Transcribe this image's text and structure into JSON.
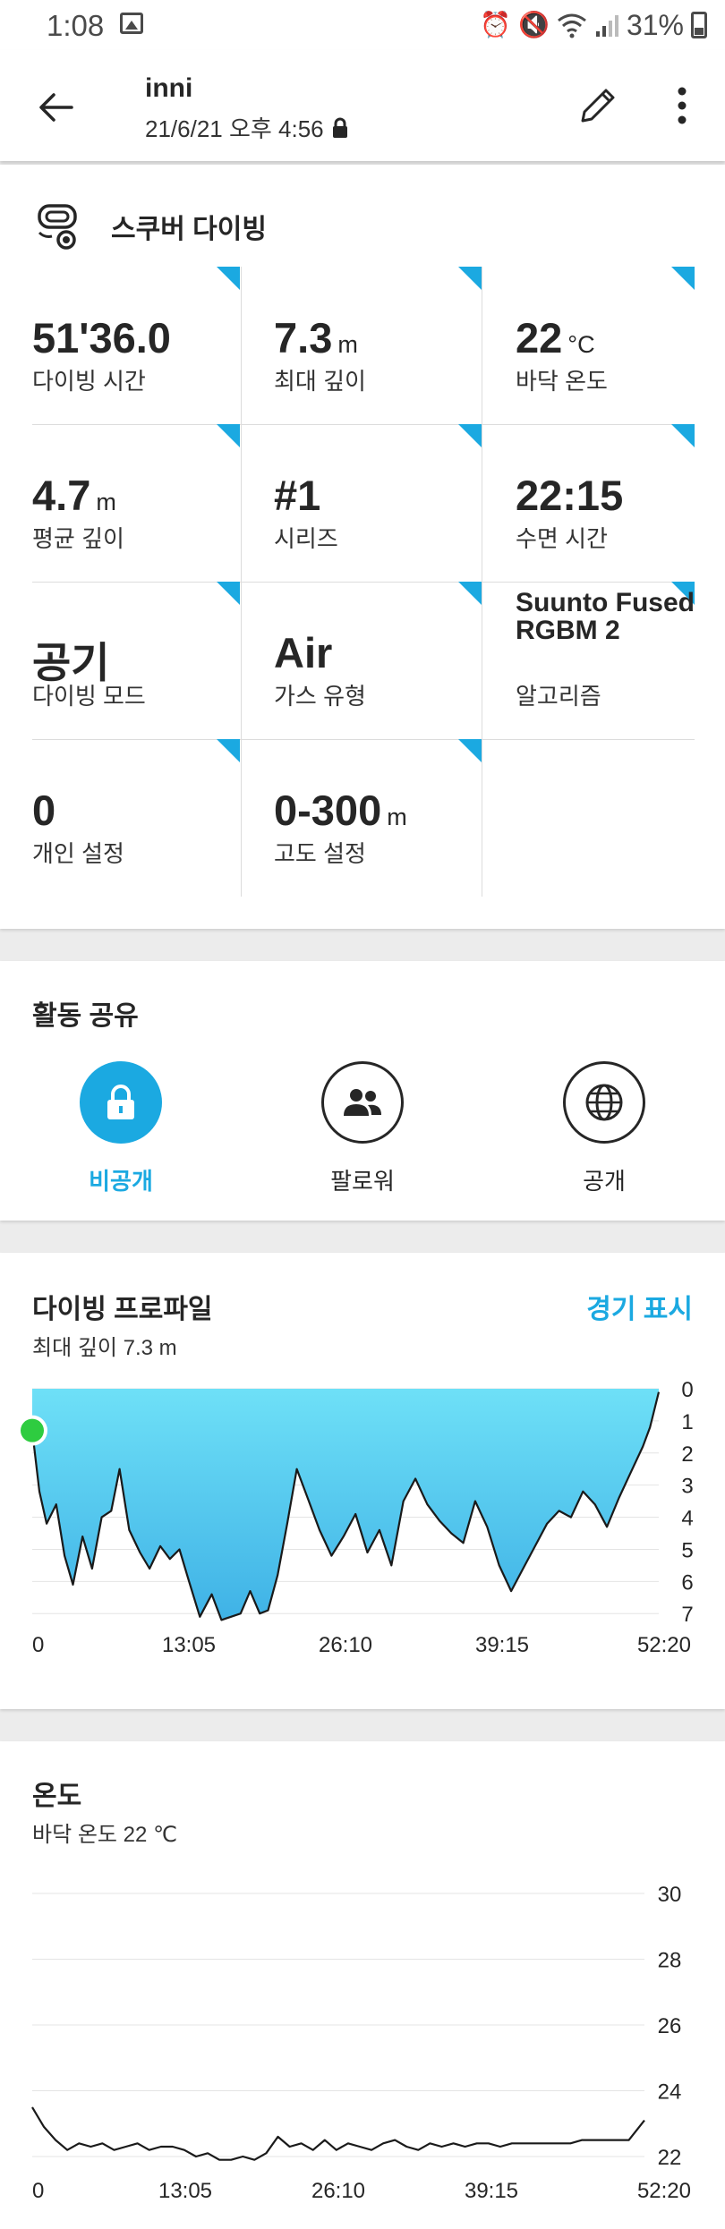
{
  "status_bar": {
    "time": "1:08",
    "battery": "31%"
  },
  "header": {
    "title": "inni",
    "datetime": "21/6/21 오후 4:56"
  },
  "activity": {
    "name": "스쿠버 다이빙"
  },
  "stats": [
    {
      "value": "51'36.0",
      "unit": "",
      "label": "다이빙 시간"
    },
    {
      "value": "7.3",
      "unit": "m",
      "label": "최대 깊이"
    },
    {
      "value": "22",
      "unit": "°C",
      "label": "바닥 온도"
    },
    {
      "value": "4.7",
      "unit": "m",
      "label": "평균 깊이"
    },
    {
      "value": "#1",
      "unit": "",
      "label": "시리즈"
    },
    {
      "value": "22:15",
      "unit": "",
      "label": "수면 시간"
    },
    {
      "value": "공기",
      "unit": "",
      "label": "다이빙 모드"
    },
    {
      "value": "Air",
      "unit": "",
      "label": "가스 유형"
    },
    {
      "value": "Suunto Fused RGBM 2",
      "unit": "",
      "label": "알고리즘"
    },
    {
      "value": "0",
      "unit": "",
      "label": "개인 설정"
    },
    {
      "value": "0-300",
      "unit": "m",
      "label": "고도 설정"
    }
  ],
  "share": {
    "title": "활동 공유",
    "options": [
      {
        "label": "비공개",
        "selected": true
      },
      {
        "label": "팔로워",
        "selected": false
      },
      {
        "label": "공개",
        "selected": false
      }
    ]
  },
  "profile": {
    "title": "다이빙 프로파일",
    "link": "경기 표시",
    "subtitle": "최대 깊이 7.3 m"
  },
  "temperature": {
    "title": "온도",
    "subtitle": "바닥 온도 22 ℃"
  },
  "colors": {
    "accent": "#1ba9e1",
    "corner": "#1ba9e1",
    "depth_fill_top": "#6ee0f7",
    "depth_fill_bottom": "#3fb2e6",
    "start_marker": "#2ecc40"
  },
  "chart_data": [
    {
      "type": "area",
      "x_tick_labels": [
        "0",
        "13:05",
        "26:10",
        "39:15",
        "52:20"
      ],
      "y_tick_labels": [
        "0",
        "1",
        "2",
        "3",
        "4",
        "5",
        "6",
        "7"
      ],
      "ylim": [
        0,
        7.3
      ],
      "y_inverted": true,
      "xlim": [
        0,
        52.33
      ],
      "series": [
        {
          "x": [
            0,
            0.6,
            1.2,
            2,
            2.7,
            3.4,
            4.2,
            5,
            5.8,
            6.6,
            7.3,
            8.1,
            9,
            9.8,
            10.7,
            11.5,
            12.3,
            13.1,
            14,
            15,
            15.8,
            16.6,
            17.4,
            18.2,
            19,
            19.7,
            20.5,
            21.3,
            22.1,
            23,
            24,
            25,
            26,
            27,
            28,
            29,
            30,
            31,
            32,
            33,
            34,
            35,
            36,
            37,
            38,
            39,
            40,
            41,
            42,
            43,
            44,
            45,
            46,
            47,
            48,
            49,
            50,
            51,
            51.6,
            52.33
          ],
          "y": [
            1.3,
            3.2,
            4.2,
            3.6,
            5.2,
            6.1,
            4.6,
            5.6,
            4.0,
            3.8,
            2.5,
            4.4,
            5.1,
            5.6,
            4.9,
            5.3,
            5.0,
            6.0,
            7.1,
            6.4,
            7.2,
            7.1,
            7.0,
            6.3,
            7.0,
            6.9,
            5.8,
            4.2,
            2.5,
            3.4,
            4.4,
            5.2,
            4.6,
            3.9,
            5.1,
            4.4,
            5.5,
            3.5,
            2.8,
            3.6,
            4.1,
            4.5,
            4.8,
            3.5,
            4.3,
            5.5,
            6.3,
            5.6,
            4.9,
            4.2,
            3.8,
            4.0,
            3.2,
            3.6,
            4.3,
            3.4,
            2.6,
            1.8,
            1.2,
            0.1
          ]
        }
      ]
    },
    {
      "type": "line",
      "x_tick_labels": [
        "0",
        "13:05",
        "26:10",
        "39:15",
        "52:20"
      ],
      "y_tick_labels": [
        "30",
        "28",
        "26",
        "24",
        "22"
      ],
      "ylim": [
        21.5,
        30
      ],
      "xlim": [
        0,
        52.33
      ],
      "series": [
        {
          "x": [
            0,
            1,
            2,
            3,
            4,
            5,
            6,
            7,
            8,
            9,
            10,
            11,
            12,
            13,
            14,
            15,
            16,
            17,
            18,
            19,
            20,
            21,
            22,
            23,
            24,
            25,
            26,
            27,
            28,
            29,
            30,
            31,
            32,
            33,
            34,
            35,
            36,
            37,
            38,
            39,
            40,
            41,
            42,
            43,
            44,
            45,
            46,
            47,
            48,
            49,
            50,
            51,
            52.33
          ],
          "y": [
            23.5,
            22.9,
            22.5,
            22.2,
            22.4,
            22.3,
            22.4,
            22.2,
            22.3,
            22.4,
            22.2,
            22.3,
            22.3,
            22.2,
            22.0,
            22.1,
            21.9,
            21.9,
            22.0,
            21.9,
            22.1,
            22.6,
            22.3,
            22.4,
            22.2,
            22.5,
            22.2,
            22.4,
            22.3,
            22.2,
            22.4,
            22.5,
            22.3,
            22.2,
            22.4,
            22.3,
            22.4,
            22.3,
            22.4,
            22.4,
            22.3,
            22.4,
            22.4,
            22.4,
            22.4,
            22.4,
            22.4,
            22.5,
            22.5,
            22.5,
            22.5,
            22.5,
            23.1
          ]
        }
      ]
    }
  ]
}
